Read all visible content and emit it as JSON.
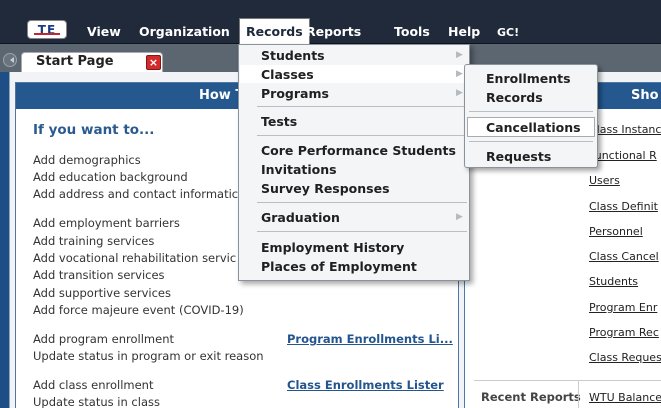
{
  "menubar": {
    "logo": "TE",
    "items": [
      "View",
      "Organization",
      "Records",
      "Reports",
      "Tools",
      "Help",
      "GC!"
    ]
  },
  "tab": {
    "label": "Start Page",
    "close": "×"
  },
  "left_panel": {
    "header": "How T",
    "intro": "If you want to...",
    "actions": [
      "Add demographics",
      "Add education background",
      "Add address and contact informatic",
      "Add employment barriers",
      "Add training services",
      "Add vocational rehabilitation servic",
      "Add transition services",
      "Add supportive services",
      "Add force majeure event (COVID-19)",
      "Add program enrollment",
      "Update status in program or exit reason",
      "Add class enrollment",
      "Update status in class"
    ],
    "links": [
      "Program Enrollments Li...",
      "Class Enrollments Lister"
    ]
  },
  "right_panel": {
    "header": "Sho",
    "links": [
      "Class Instanc",
      "Functional R",
      "Users",
      "Class Definit",
      "Personnel",
      "Class Cancel",
      "Students",
      "Program Enr",
      "Program Rec",
      "Class Reques"
    ],
    "recent_label": "Recent Reports",
    "recent_link": "WTU Balance"
  },
  "records_menu": {
    "items": [
      "Students",
      "Classes",
      "Programs",
      "Tests",
      "Core Performance Students",
      "Invitations",
      "Survey Responses",
      "Graduation",
      "Employment History",
      "Places of Employment"
    ]
  },
  "classes_submenu": {
    "items": [
      "Enrollments",
      "Records",
      "Cancellations",
      "Requests"
    ]
  },
  "colors": {
    "header": "#24588f",
    "menubar": "#202a3a",
    "link": "#23558f",
    "close": "#d32b2b"
  }
}
